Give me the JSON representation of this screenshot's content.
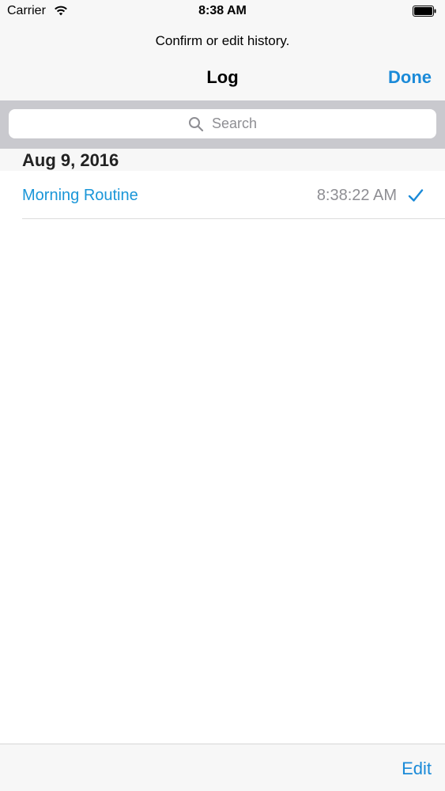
{
  "status_bar": {
    "carrier": "Carrier",
    "time": "8:38 AM"
  },
  "nav": {
    "prompt": "Confirm or edit history.",
    "title": "Log",
    "done_label": "Done"
  },
  "search": {
    "placeholder": "Search"
  },
  "sections": [
    {
      "header": "Aug 9, 2016",
      "rows": [
        {
          "title": "Morning Routine",
          "time": "8:38:22 AM",
          "checked": true
        }
      ]
    }
  ],
  "toolbar": {
    "edit_label": "Edit"
  },
  "colors": {
    "accent": "#1a8ad8",
    "row_title": "#1a96d8",
    "secondary_text": "#8e8e93",
    "bar_background": "#f7f7f7",
    "search_background": "#c9c9ce"
  },
  "icons": {
    "wifi": "wifi-icon",
    "battery": "battery-icon",
    "search": "search-icon",
    "check": "checkmark-icon"
  }
}
